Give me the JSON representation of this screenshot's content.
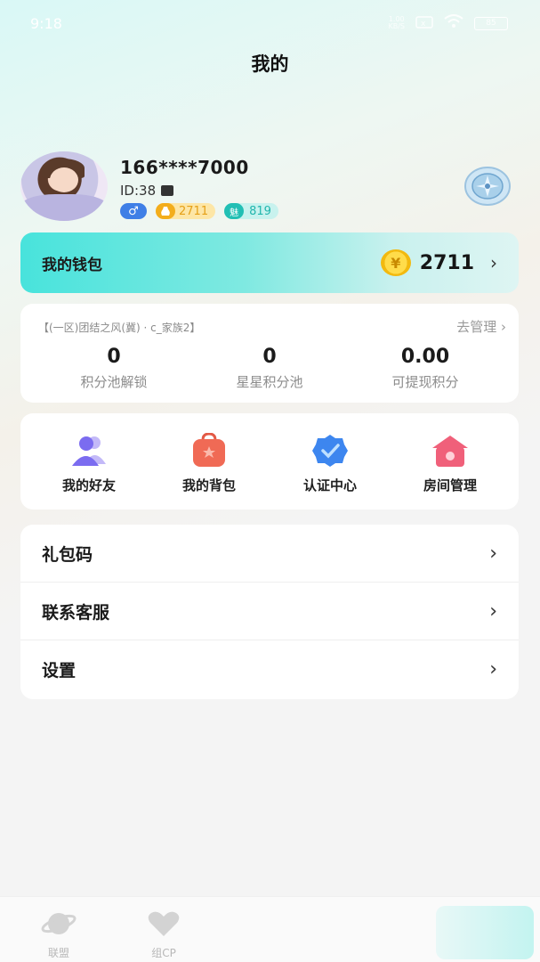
{
  "status_bar": {
    "time": "9:18",
    "net_speed": "1.00\nKB/S",
    "battery": "85"
  },
  "header": {
    "title": "我的"
  },
  "profile": {
    "phone": "166****7000",
    "user_id": "ID:38",
    "gender_symbol": "♂",
    "coins_badge": "2711",
    "charm_icon_text": "魅",
    "charm_badge": "819"
  },
  "wallet": {
    "title": "我的钱包",
    "coin_symbol": "¥",
    "amount": "2711",
    "chevron": "›"
  },
  "family": {
    "name": "【(一区)团结之风(冀) · c_家族2】",
    "manage_label": "去管理 ›",
    "stats": [
      {
        "value": "0",
        "label": "积分池解锁"
      },
      {
        "value": "0",
        "label": "星星积分池"
      },
      {
        "value": "0.00",
        "label": "可提现积分"
      }
    ]
  },
  "shortcuts": [
    {
      "label": "我的好友",
      "icon": "friends-icon"
    },
    {
      "label": "我的背包",
      "icon": "backpack-icon"
    },
    {
      "label": "认证中心",
      "icon": "verify-badge-icon"
    },
    {
      "label": "房间管理",
      "icon": "room-house-icon"
    }
  ],
  "menu": [
    {
      "label": "礼包码",
      "arrow": "›"
    },
    {
      "label": "联系客服",
      "arrow": "›"
    },
    {
      "label": "设置",
      "arrow": "›"
    }
  ],
  "tabbar": {
    "tabs": [
      {
        "label": "联盟",
        "icon": "planet-icon"
      },
      {
        "label": "组CP",
        "icon": "heart-icon"
      }
    ]
  },
  "colors": {
    "wallet_gradient_start": "#48e3dc",
    "gender_badge": "#3f7fe6",
    "coin_badge": "#f3ad1b",
    "charm_badge": "#22bfb4",
    "friends_icon": "#7b6cf0",
    "backpack_icon": "#f06a55",
    "verify_icon": "#3d86ef",
    "room_icon": "#f0607a"
  }
}
